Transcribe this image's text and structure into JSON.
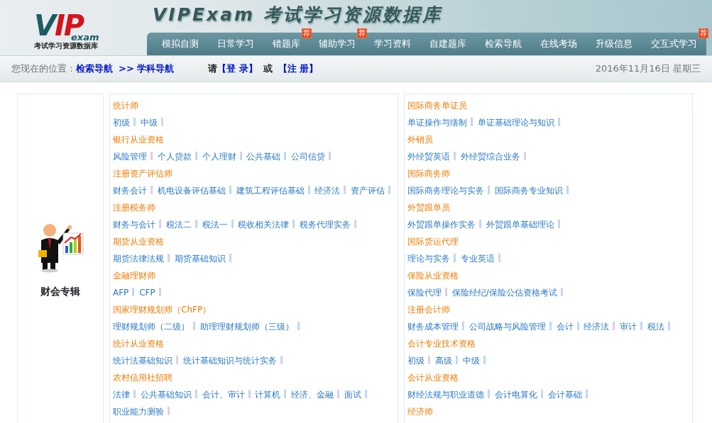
{
  "header": {
    "logo": {
      "letters_v": "V",
      "letters_ip": "IP",
      "word": "exam",
      "tagline": "考试学习资源数据库"
    },
    "site_title": "VIPExam 考试学习资源数据库"
  },
  "nav": [
    {
      "label": "模拟自测"
    },
    {
      "label": "日常学习"
    },
    {
      "label": "错题库",
      "badge": "荐"
    },
    {
      "label": "辅助学习",
      "badge": "荐"
    },
    {
      "label": "学习资料"
    },
    {
      "label": "自建题库"
    },
    {
      "label": "检索导航"
    },
    {
      "label": "在线考场"
    },
    {
      "label": "升级信息"
    },
    {
      "label": "交互式学习",
      "badge": "荐"
    }
  ],
  "breadcrumb": {
    "prefix": "您现在的位置：",
    "links": [
      "检索导航",
      ">> 学科导航"
    ],
    "login_prompt": "请",
    "login": "【登 录】",
    "or": "或",
    "register": "【注 册】",
    "date": "2016年11月16日 星期三"
  },
  "category": {
    "label": "财会专辑"
  },
  "columns": [
    [
      {
        "title": "统计师",
        "items": [
          "初级",
          "中级"
        ]
      },
      {
        "title": "银行从业资格",
        "items": [
          "风险管理",
          "个人贷款",
          "个人理财",
          "公共基础",
          "公司信贷"
        ]
      },
      {
        "title": "注册资产评估师",
        "items": [
          "财务会计",
          "机电设备评估基础",
          "建筑工程评估基础",
          "经济法",
          "资产评估"
        ]
      },
      {
        "title": "注册税务师",
        "items": [
          "财务与会计",
          "税法二",
          "税法一",
          "税收相关法律",
          "税务代理实务"
        ]
      },
      {
        "title": "期货从业资格",
        "items": [
          "期货法律法规",
          "期货基础知识"
        ]
      },
      {
        "title": "金融理财师",
        "items": [
          "AFP",
          "CFP"
        ]
      },
      {
        "title": "国家理财规划师（ChFP）",
        "items": [
          "理财规划师（二级）",
          "助理理财规划师（三级）"
        ]
      },
      {
        "title": "统计从业资格",
        "items": [
          "统计法基础知识",
          "统计基础知识与统计实务"
        ]
      },
      {
        "title": "农村信用社招聘",
        "items": [
          "法律",
          "公共基础知识",
          "会计、审计",
          "计算机",
          "经济、金融",
          "面试",
          "职业能力测验"
        ]
      }
    ],
    [
      {
        "title": "国际商务单证员",
        "items": [
          "单证操作与缮制",
          "单证基础理论与知识"
        ]
      },
      {
        "title": "外销员",
        "items": [
          "外经贸英语",
          "外经贸综合业务"
        ]
      },
      {
        "title": "国际商务师",
        "items": [
          "国际商务理论与实务",
          "国际商务专业知识"
        ]
      },
      {
        "title": "外贸跟单员",
        "items": [
          "外贸跟单操作实务",
          "外贸跟单基础理论"
        ]
      },
      {
        "title": "国际货运代理",
        "items": [
          "理论与实务",
          "专业英语"
        ]
      },
      {
        "title": "保险从业资格",
        "items": [
          "保险代理",
          "保险经纪/保险公估资格考试"
        ]
      },
      {
        "title": "注册会计师",
        "items": [
          "财务成本管理",
          "公司战略与风险管理",
          "会计",
          "经济法",
          "审计",
          "税法"
        ]
      },
      {
        "title": "会计专业技术资格",
        "items": [
          "初级",
          "高级",
          "中级"
        ]
      },
      {
        "title": "会计从业资格",
        "items": [
          "财经法规与职业道德",
          "会计电算化",
          "会计基础"
        ]
      },
      {
        "title": "经济师"
      }
    ]
  ]
}
